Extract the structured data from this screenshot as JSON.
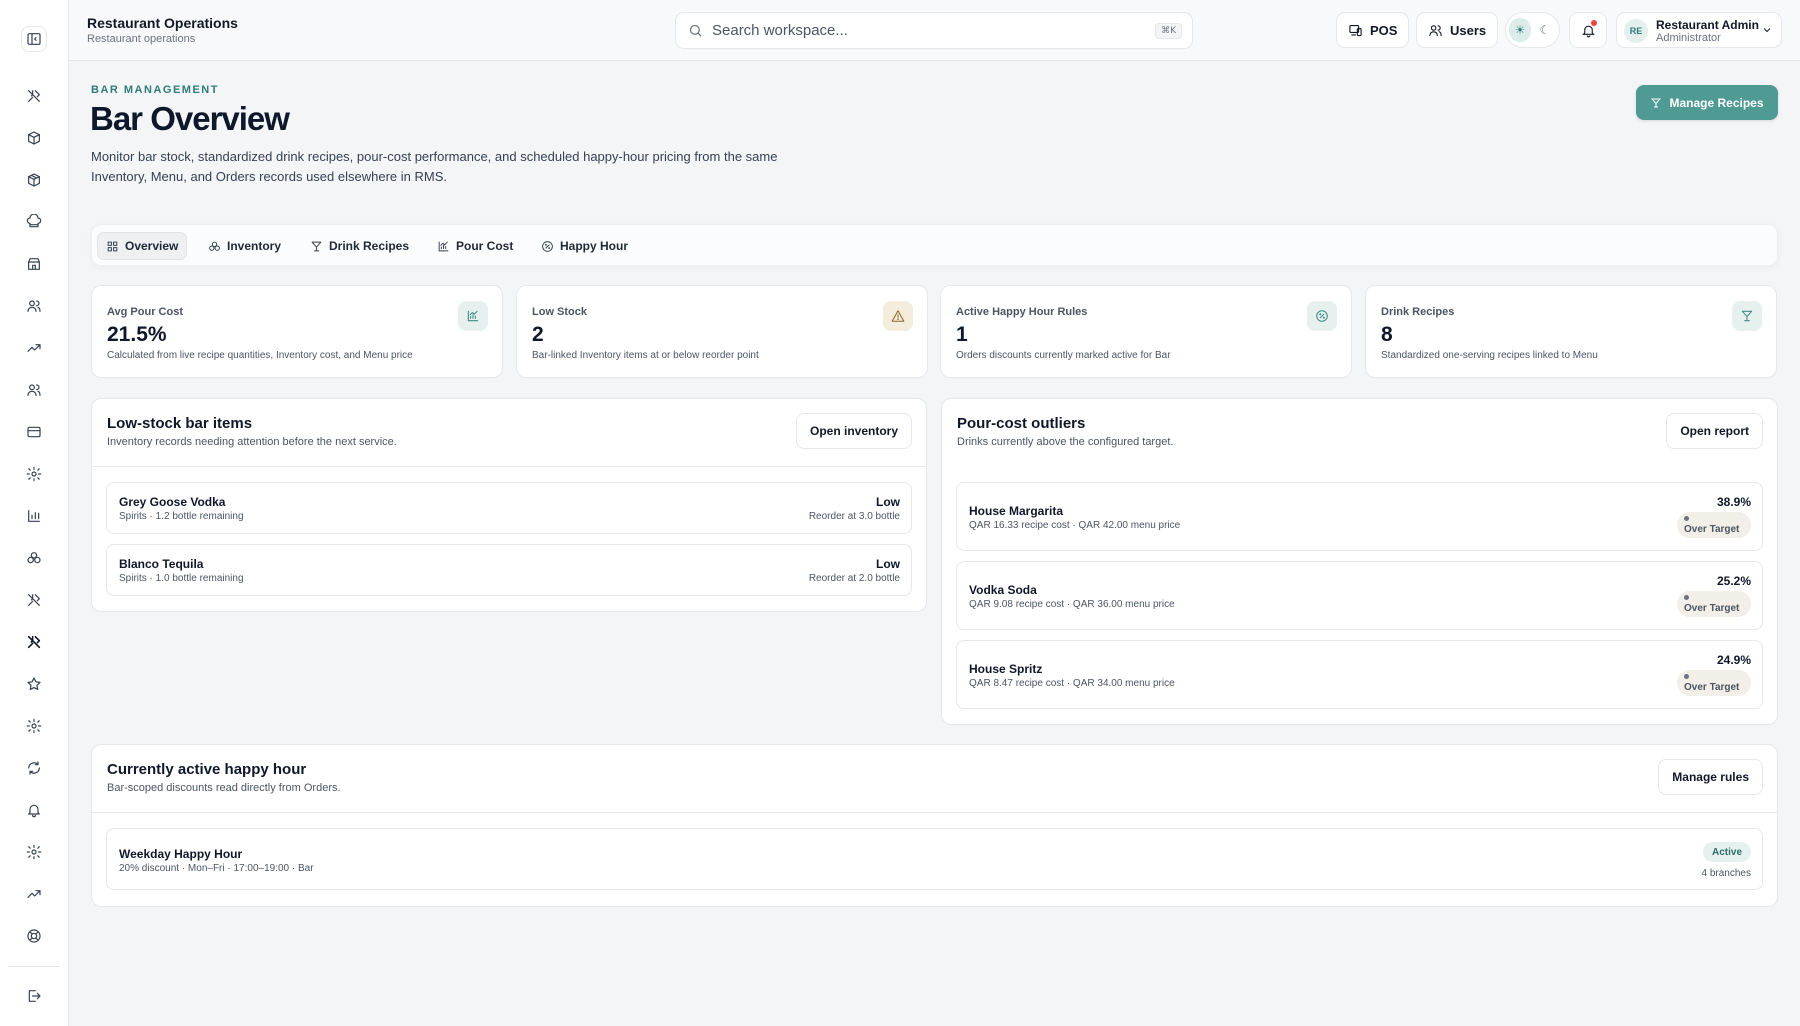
{
  "app": {
    "title": "Restaurant Operations",
    "subtitle": "Restaurant operations"
  },
  "search": {
    "placeholder": "Search workspace...",
    "shortcut": "⌘K"
  },
  "header": {
    "pos_label": "POS",
    "users_label": "Users",
    "notifications_unread": true,
    "user": {
      "initials": "RE",
      "name": "Restaurant Admin",
      "role": "Administrator"
    }
  },
  "sidebar": {
    "icons": [
      "sidebar-toggle-icon",
      "utensils-icon",
      "box-icon",
      "package-icon",
      "chef-hat-icon",
      "store-icon",
      "users-icon",
      "trending-up-icon",
      "team-icon",
      "credit-card-icon",
      "settings-icon",
      "bar-chart-icon",
      "ingredients-icon",
      "utensils-icon",
      "utensils-active-icon",
      "star-icon",
      "gear-icon",
      "refresh-icon",
      "bell-icon",
      "gear-icon",
      "trending-up-icon",
      "support-icon",
      "logout-icon"
    ]
  },
  "page": {
    "eyebrow": "BAR MANAGEMENT",
    "title": "Bar Overview",
    "description": "Monitor bar stock, standardized drink recipes, pour-cost performance, and scheduled happy-hour pricing from the same Inventory, Menu, and Orders records used elsewhere in RMS.",
    "primary_action": "Manage Recipes"
  },
  "tabs": [
    {
      "label": "Overview",
      "active": true
    },
    {
      "label": "Inventory",
      "active": false
    },
    {
      "label": "Drink Recipes",
      "active": false
    },
    {
      "label": "Pour Cost",
      "active": false
    },
    {
      "label": "Happy Hour",
      "active": false
    }
  ],
  "stats": [
    {
      "label": "Avg Pour Cost",
      "value": "21.5%",
      "description": "Calculated from live recipe quantities, Inventory cost, and Menu price",
      "icon": "chart-icon"
    },
    {
      "label": "Low Stock",
      "value": "2",
      "description": "Bar-linked Inventory items at or below reorder point",
      "icon": "warning-icon"
    },
    {
      "label": "Active Happy Hour Rules",
      "value": "1",
      "description": "Orders discounts currently marked active for Bar",
      "icon": "discount-icon"
    },
    {
      "label": "Drink Recipes",
      "value": "8",
      "description": "Standardized one-serving recipes linked to Menu",
      "icon": "cocktail-icon"
    }
  ],
  "low_stock": {
    "title": "Low-stock bar items",
    "subtitle": "Inventory records needing attention before the next service.",
    "action": "Open inventory",
    "items": [
      {
        "name": "Grey Goose Vodka",
        "meta": "Spirits · 1.2 bottle remaining",
        "status": "Low",
        "reorder": "Reorder at 3.0 bottle"
      },
      {
        "name": "Blanco Tequila",
        "meta": "Spirits · 1.0 bottle remaining",
        "status": "Low",
        "reorder": "Reorder at 2.0 bottle"
      }
    ]
  },
  "outliers": {
    "title": "Pour-cost outliers",
    "subtitle": "Drinks currently above the configured target.",
    "action": "Open report",
    "items": [
      {
        "name": "House Margarita",
        "meta": "QAR 16.33 recipe cost · QAR 42.00 menu price",
        "percent": "38.9%",
        "badge": "Over Target"
      },
      {
        "name": "Vodka Soda",
        "meta": "QAR 9.08 recipe cost · QAR 36.00 menu price",
        "percent": "25.2%",
        "badge": "Over Target"
      },
      {
        "name": "House Spritz",
        "meta": "QAR 8.47 recipe cost · QAR 34.00 menu price",
        "percent": "24.9%",
        "badge": "Over Target"
      }
    ]
  },
  "happy_hour": {
    "title": "Currently active happy hour",
    "subtitle": "Bar-scoped discounts read directly from Orders.",
    "action": "Manage rules",
    "items": [
      {
        "name": "Weekday Happy Hour",
        "meta": "20% discount · Mon–Fri · 17:00–19:00 · Bar",
        "status": "Active",
        "branches": "4 branches"
      }
    ]
  },
  "colors": {
    "accent": "#4f9a93",
    "accent_text": "#2e7d76",
    "page_bg": "#f3f5f7",
    "notification_dot": "#ef4444"
  }
}
